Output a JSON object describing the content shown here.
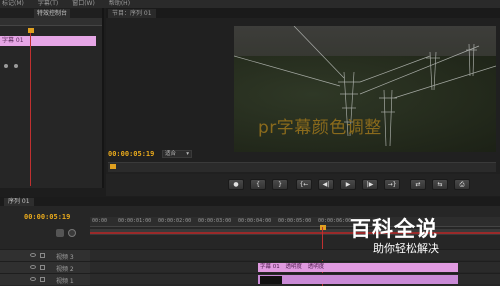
{
  "menu": {
    "items": [
      "标记(M)",
      "字幕(T)",
      "窗口(W)",
      "帮助(H)"
    ]
  },
  "left_panel": {
    "tabs": [
      "",
      "特效控制台"
    ],
    "clip_label": "字幕 01"
  },
  "monitor": {
    "tab_label": "节目：序列 01",
    "caption": "pr字幕颜色调整",
    "timecode": "00:00:05:19",
    "fit": "适合"
  },
  "transport": {
    "buttons": [
      "●",
      "{",
      "}",
      "{←",
      "◀|",
      "▶",
      "|▶",
      "→}",
      "⇄",
      "⇆",
      "⎙"
    ]
  },
  "timeline": {
    "tab_label": "序列 01",
    "timecode": "00:00:05:19",
    "ruler_ticks": [
      "00:00",
      "00:00:01:00",
      "00:00:02:00",
      "00:00:03:00",
      "00:00:04:00",
      "00:00:05:00",
      "00:00:06:00"
    ],
    "tracks": [
      {
        "label": "视频 3"
      },
      {
        "label": "视频 2"
      },
      {
        "label": "视频 1"
      }
    ],
    "clips": [
      "字幕 01",
      "透明度",
      "透明度"
    ]
  },
  "watermark": {
    "title": "百科全说",
    "subtitle": "助你轻松解决"
  },
  "colors": {
    "accent": "#e8a91c",
    "clip_pink": "#e09ae0",
    "playhead": "#c03030"
  }
}
